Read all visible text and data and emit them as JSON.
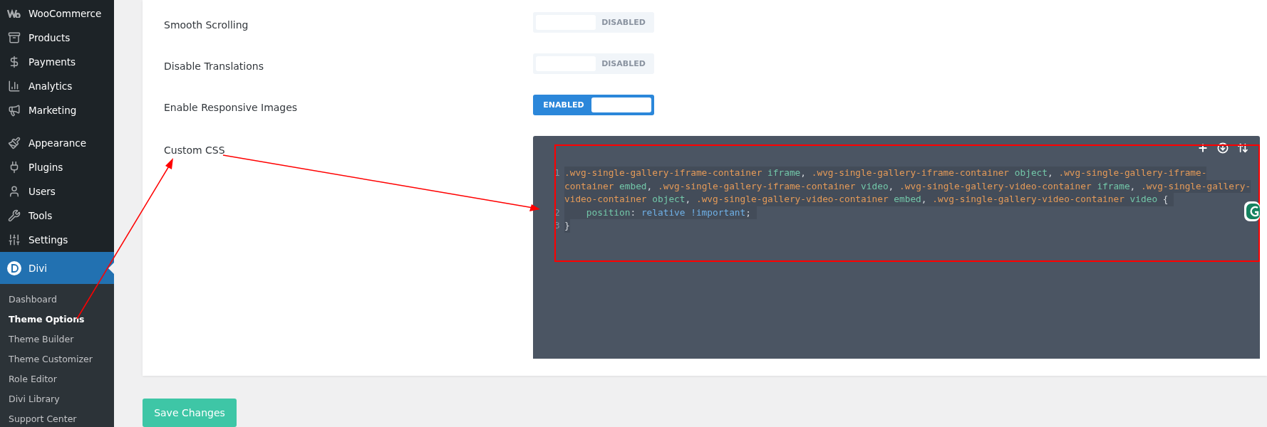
{
  "sidebar": {
    "groups": [
      {
        "items": [
          {
            "label": "WooCommerce",
            "selected": false
          },
          {
            "label": "Products",
            "selected": false
          },
          {
            "label": "Payments",
            "selected": false
          },
          {
            "label": "Analytics",
            "selected": false
          },
          {
            "label": "Marketing",
            "selected": false
          }
        ]
      },
      {
        "items": [
          {
            "label": "Appearance",
            "selected": false
          },
          {
            "label": "Plugins",
            "selected": false
          },
          {
            "label": "Users",
            "selected": false
          },
          {
            "label": "Tools",
            "selected": false
          },
          {
            "label": "Settings",
            "selected": false
          },
          {
            "label": "Divi",
            "selected": true
          }
        ]
      }
    ],
    "submenu": [
      {
        "label": "Dashboard",
        "selected": false
      },
      {
        "label": "Theme Options",
        "selected": true
      },
      {
        "label": "Theme Builder",
        "selected": false
      },
      {
        "label": "Theme Customizer",
        "selected": false
      },
      {
        "label": "Role Editor",
        "selected": false
      },
      {
        "label": "Divi Library",
        "selected": false
      },
      {
        "label": "Support Center",
        "selected": false
      }
    ]
  },
  "settings": [
    {
      "label": "Smooth Scrolling",
      "on": false,
      "toggle_label": "DISABLED"
    },
    {
      "label": "Disable Translations",
      "on": false,
      "toggle_label": "DISABLED"
    },
    {
      "label": "Enable Responsive Images",
      "on": true,
      "toggle_label": "ENABLED"
    }
  ],
  "custom_css": {
    "label": "Custom CSS",
    "lines": [
      {
        "number": "1",
        "rows": [
          {
            "tokens": [
              {
                "kind": "selector",
                "text": ".wvg-single-gallery-iframe-container"
              },
              {
                "kind": "tag",
                "text": " iframe"
              },
              {
                "kind": "punct",
                "text": ", "
              },
              {
                "kind": "selector",
                "text": ".wvg-single-gallery-iframe-container"
              },
              {
                "kind": "tag",
                "text": " object"
              },
              {
                "kind": "punct",
                "text": ", "
              },
              {
                "kind": "selector",
                "text": ".wvg-single-gallery-iframe-"
              }
            ]
          },
          {
            "tokens": [
              {
                "kind": "selector",
                "text": "container"
              },
              {
                "kind": "tag",
                "text": " embed"
              },
              {
                "kind": "punct",
                "text": ", "
              },
              {
                "kind": "selector",
                "text": ".wvg-single-gallery-iframe-container"
              },
              {
                "kind": "tag",
                "text": " video"
              },
              {
                "kind": "punct",
                "text": ", "
              },
              {
                "kind": "selector",
                "text": ".wvg-single-gallery-video-container"
              },
              {
                "kind": "tag",
                "text": " iframe"
              },
              {
                "kind": "punct",
                "text": ", "
              },
              {
                "kind": "selector",
                "text": ".wvg-single-gallery-"
              }
            ]
          },
          {
            "tokens": [
              {
                "kind": "selector",
                "text": "video-container"
              },
              {
                "kind": "tag",
                "text": " object"
              },
              {
                "kind": "punct",
                "text": ", "
              },
              {
                "kind": "selector",
                "text": ".wvg-single-gallery-video-container"
              },
              {
                "kind": "tag",
                "text": " embed"
              },
              {
                "kind": "punct",
                "text": ", "
              },
              {
                "kind": "selector",
                "text": ".wvg-single-gallery-video-container"
              },
              {
                "kind": "tag",
                "text": " video"
              },
              {
                "kind": "punct",
                "text": " { "
              }
            ]
          }
        ]
      },
      {
        "number": "2",
        "rows": [
          {
            "indented": true,
            "tokens": [
              {
                "kind": "property",
                "text": "position"
              },
              {
                "kind": "punct",
                "text": ": "
              },
              {
                "kind": "value",
                "text": "relative !important"
              },
              {
                "kind": "punct",
                "text": "; "
              }
            ]
          }
        ]
      },
      {
        "number": "3",
        "rows": [
          {
            "tokens": [
              {
                "kind": "punct",
                "text": "}"
              }
            ]
          }
        ]
      }
    ]
  },
  "save_button": "Save Changes"
}
